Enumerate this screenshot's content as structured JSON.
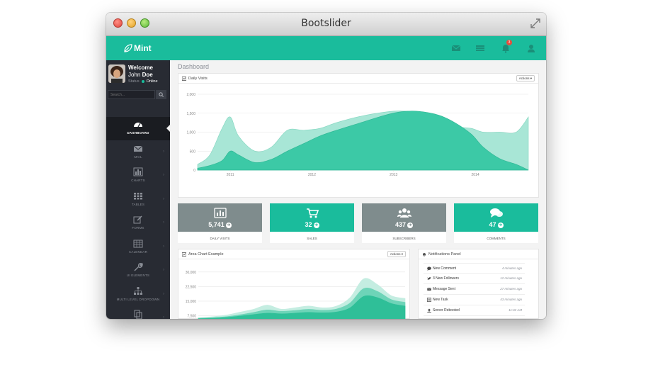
{
  "window": {
    "title": "Bootslider"
  },
  "brand": {
    "name": "Mint"
  },
  "profile": {
    "welcome": "Welcome",
    "first_name": "John",
    "last_name": "Doe",
    "status_label": "Status",
    "status_value": "Online"
  },
  "search": {
    "placeholder": "Search..."
  },
  "nav": [
    {
      "label": "DASHBOARD",
      "icon": "dashboard-icon",
      "active": true
    },
    {
      "label": "MAIL",
      "icon": "mail-icon"
    },
    {
      "label": "CHARTS",
      "icon": "bar-chart-icon"
    },
    {
      "label": "TABLES",
      "icon": "table-icon"
    },
    {
      "label": "FORMS",
      "icon": "edit-icon"
    },
    {
      "label": "CALENDAR",
      "icon": "calendar-icon"
    },
    {
      "label": "UI ELEMENTS",
      "icon": "wrench-icon"
    },
    {
      "label": "MULTI LEVEL DROPDOWN",
      "icon": "sitemap-icon"
    },
    {
      "label": "SAMPLE PAGES",
      "icon": "files-icon"
    }
  ],
  "topbar": {
    "notification_count": "3",
    "icons": [
      "envelope-icon",
      "list-icon",
      "bell-icon",
      "user-icon"
    ]
  },
  "page": {
    "title": "Dashboard"
  },
  "daily_visits": {
    "title": "Daily Visits",
    "actions": "Actions ▾",
    "chart_data": {
      "type": "area",
      "x": [
        2010.6,
        2010.75,
        2010.9,
        2011.0,
        2011.1,
        2011.3,
        2011.5,
        2011.7,
        2011.9,
        2012.1,
        2012.3,
        2012.6,
        2012.9,
        2013.1,
        2013.3,
        2013.55,
        2013.75,
        2013.95,
        2014.1,
        2014.3,
        2014.5,
        2014.65
      ],
      "x_ticks": [
        "2011",
        "2012",
        "2013",
        "2014"
      ],
      "x_tick_values": [
        2011,
        2012,
        2013,
        2014
      ],
      "y_ticks": [
        "0",
        "500",
        "1,000",
        "1,500",
        "2,000"
      ],
      "y_tick_values": [
        0,
        500,
        1000,
        1500,
        2000
      ],
      "ylim": [
        0,
        2000
      ],
      "series": [
        {
          "color": "#a8e6d6",
          "values": [
            150,
            400,
            1100,
            1400,
            900,
            500,
            600,
            1050,
            1050,
            1100,
            1250,
            1420,
            1530,
            1560,
            1510,
            1300,
            1150,
            1100,
            1000,
            1000,
            1000,
            1400
          ]
        },
        {
          "color": "#3cc9a6",
          "values": [
            50,
            120,
            250,
            500,
            400,
            200,
            280,
            500,
            700,
            900,
            1050,
            1250,
            1450,
            1540,
            1550,
            1450,
            1250,
            950,
            600,
            300,
            150,
            0
          ]
        }
      ]
    }
  },
  "stats": [
    {
      "value": "5,741",
      "label": "DAILY VISITS",
      "icon": "bar-chart-icon",
      "color": "#7f8c8d"
    },
    {
      "value": "32",
      "label": "SALES",
      "icon": "cart-icon",
      "color": "#1abc9c"
    },
    {
      "value": "437",
      "label": "SUBSCRIBERS",
      "icon": "users-icon",
      "color": "#7f8c8d"
    },
    {
      "value": "47",
      "label": "COMMENTS",
      "icon": "comments-icon",
      "color": "#1abc9c"
    }
  ],
  "area_chart": {
    "title": "Area Chart Example",
    "actions": "Actions ▾",
    "chart_data": {
      "type": "area",
      "y_ticks": [
        "7,500",
        "15,000",
        "22,500",
        "30,000"
      ],
      "y_tick_values": [
        7500,
        15000,
        22500,
        30000
      ],
      "ylim": [
        5500,
        32500
      ],
      "x": [
        0,
        1,
        2,
        3,
        4,
        5,
        6,
        7,
        8,
        9,
        10,
        11,
        12,
        13,
        14,
        15
      ],
      "series": [
        {
          "color": "#c4ede1",
          "values": [
            6500,
            7000,
            7800,
            9300,
            10800,
            13000,
            10900,
            11600,
            12500,
            11600,
            12400,
            16800,
            26500,
            23500,
            17800,
            16400
          ]
        },
        {
          "color": "#6ed4b8",
          "values": [
            6200,
            6500,
            7000,
            8000,
            9200,
            10500,
            9800,
            10200,
            10800,
            10300,
            10900,
            14000,
            21500,
            20000,
            15800,
            14400
          ]
        },
        {
          "color": "#2fbf98",
          "values": [
            6000,
            6200,
            6600,
            7300,
            8100,
            8800,
            8500,
            8800,
            9200,
            9000,
            9400,
            11500,
            17500,
            16800,
            13800,
            12500
          ]
        }
      ]
    }
  },
  "notifications": {
    "title": "Notifications Panel",
    "items": [
      {
        "icon": "comment-icon",
        "text": "New Comment",
        "time": "4 minutes ago"
      },
      {
        "icon": "twitter-icon",
        "text": "3 New Followers",
        "time": "12 minutes ago"
      },
      {
        "icon": "envelope-icon",
        "text": "Message Sent",
        "time": "27 minutes ago"
      },
      {
        "icon": "tasks-icon",
        "text": "New Task",
        "time": "43 minutes ago"
      },
      {
        "icon": "upload-icon",
        "text": "Server Rebooted",
        "time": "11:32 AM"
      },
      {
        "icon": "bolt-icon",
        "text": "Server Crashed!",
        "time": "11:13 AM"
      }
    ]
  }
}
